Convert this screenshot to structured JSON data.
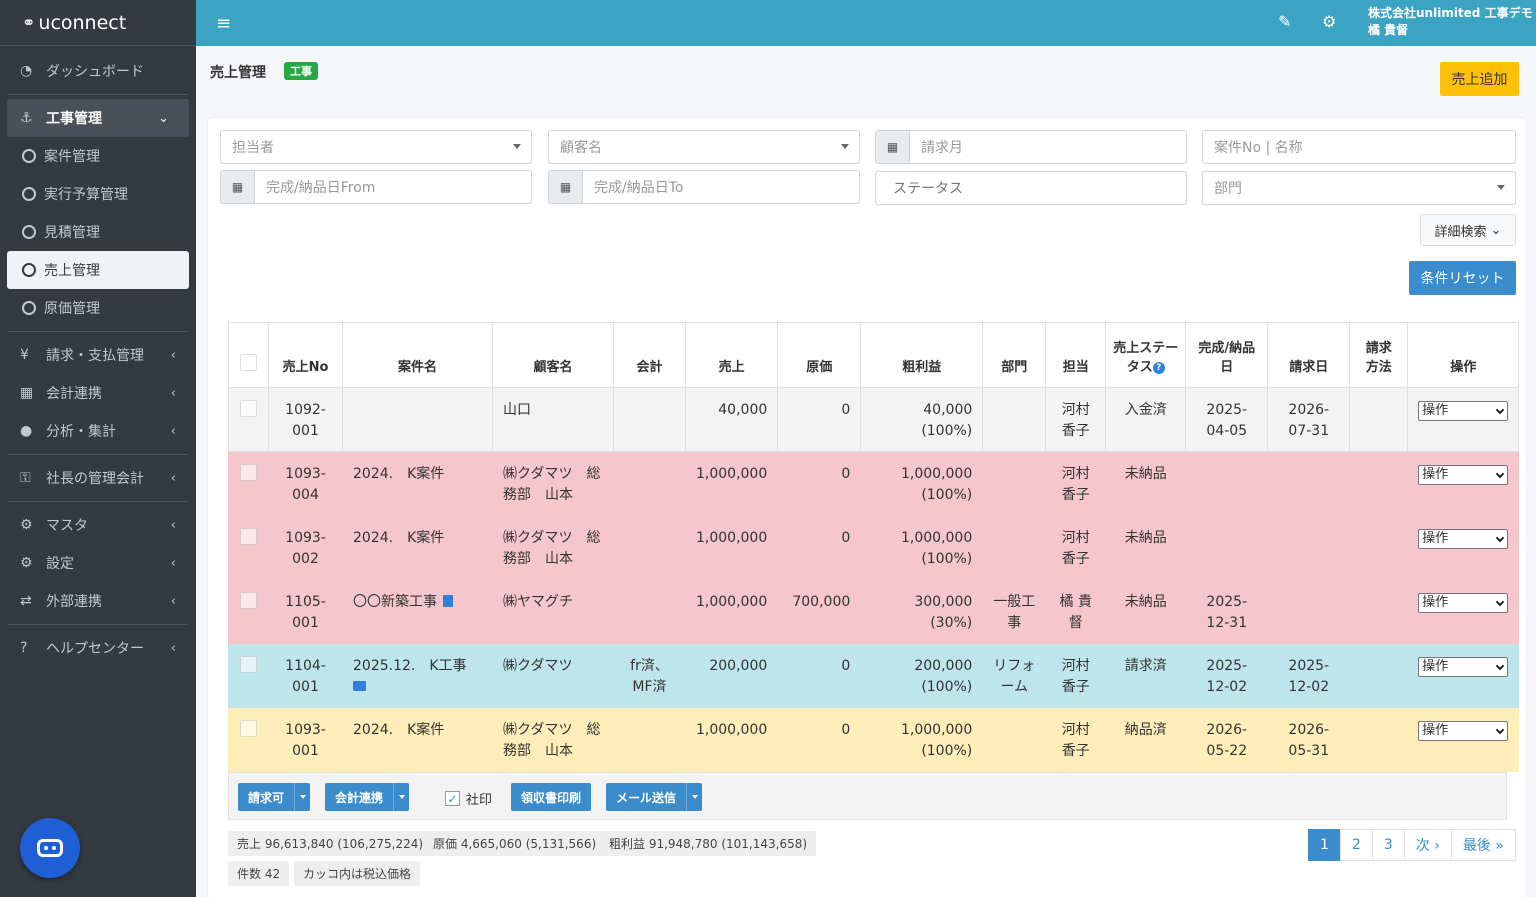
{
  "sidebar": {
    "brand": "uconnect",
    "items": [
      {
        "icon": "gauge-icon",
        "label": "ダッシュボード"
      },
      {
        "icon": "anchor-icon",
        "label": "工事管理"
      },
      {
        "label": "案件管理"
      },
      {
        "label": "実行予算管理"
      },
      {
        "label": "見積管理"
      },
      {
        "label": "売上管理"
      },
      {
        "label": "原価管理"
      },
      {
        "icon": "yen-icon",
        "label": "請求・支払管理"
      },
      {
        "icon": "calculator-icon",
        "label": "会計連携"
      },
      {
        "icon": "drop-icon",
        "label": "分析・集計"
      },
      {
        "icon": "key-icon",
        "label": "社長の管理会計"
      },
      {
        "icon": "gear-icon",
        "label": "マスタ"
      },
      {
        "icon": "gears-icon",
        "label": "設定"
      },
      {
        "icon": "exchange-icon",
        "label": "外部連携"
      },
      {
        "icon": "question-icon",
        "label": "ヘルプセンター"
      }
    ]
  },
  "topbar": {
    "company": "株式会社unlimited 工事デモ",
    "user": "橘 貴督"
  },
  "page": {
    "title": "売上管理",
    "badge": "工事",
    "add_button": "売上追加"
  },
  "filters": {
    "tantousha": "担当者",
    "kokyaku": "顧客名",
    "seikyu_month": "請求月",
    "anken": "案件No | 名称",
    "from": "完成/納品日From",
    "to": "完成/納品日To",
    "status": "ステータス",
    "bumon": "部門",
    "detail": "詳細検索",
    "reset": "条件リセット"
  },
  "table": {
    "headers": [
      "売上No",
      "案件名",
      "顧客名",
      "会計",
      "売上",
      "原価",
      "粗利益",
      "部門",
      "担当",
      "売上ステータス",
      "完成/納品日",
      "請求日",
      "請求方法",
      "操作"
    ],
    "rows": [
      {
        "no": "1092-001",
        "anken": "",
        "kokyaku": "山口",
        "kaikei": "",
        "uriage": "40,000",
        "genka": "0",
        "arari": "40,000",
        "arari_pct": "(100%)",
        "bumon": "",
        "tanto": "河村香子",
        "status": "入金済",
        "kansei": "2025-04-05",
        "seikyu": "2026-07-31",
        "hoho": "",
        "op": "操作"
      },
      {
        "no": "1093-004",
        "anken": "2024.　K案件",
        "kokyaku": "㈱クダマツ　総務部　山本",
        "kaikei": "",
        "uriage": "1,000,000",
        "genka": "0",
        "arari": "1,000,000",
        "arari_pct": "(100%)",
        "bumon": "",
        "tanto": "河村香子",
        "status": "未納品",
        "kansei": "",
        "seikyu": "",
        "hoho": "",
        "op": "操作"
      },
      {
        "no": "1093-002",
        "anken": "2024.　K案件",
        "kokyaku": "㈱クダマツ　総務部　山本",
        "kaikei": "",
        "uriage": "1,000,000",
        "genka": "0",
        "arari": "1,000,000",
        "arari_pct": "(100%)",
        "bumon": "",
        "tanto": "河村香子",
        "status": "未納品",
        "kansei": "",
        "seikyu": "",
        "hoho": "",
        "op": "操作"
      },
      {
        "no": "1105-001",
        "anken": "〇〇新築工事",
        "kokyaku": "㈱ヤマグチ",
        "kaikei": "",
        "uriage": "1,000,000",
        "genka": "700,000",
        "arari": "300,000",
        "arari_pct": "(30%)",
        "bumon": "一般工事",
        "tanto": "橘 貴督",
        "status": "未納品",
        "kansei": "2025-12-31",
        "seikyu": "",
        "hoho": "",
        "op": "操作"
      },
      {
        "no": "1104-001",
        "anken": "2025.12.　K工事",
        "kokyaku": "㈱クダマツ",
        "kaikei": "fr済、MF済",
        "uriage": "200,000",
        "genka": "0",
        "arari": "200,000",
        "arari_pct": "(100%)",
        "bumon": "リフォーム",
        "tanto": "河村香子",
        "status": "請求済",
        "kansei": "2025-12-02",
        "seikyu": "2025-12-02",
        "hoho": "",
        "op": "操作"
      },
      {
        "no": "1093-001",
        "anken": "2024.　K案件",
        "kokyaku": "㈱クダマツ　総務部　山本",
        "kaikei": "",
        "uriage": "1,000,000",
        "genka": "0",
        "arari": "1,000,000",
        "arari_pct": "(100%)",
        "bumon": "",
        "tanto": "河村香子",
        "status": "納品済",
        "kansei": "2026-05-22",
        "seikyu": "2026-05-31",
        "hoho": "",
        "op": "操作"
      }
    ]
  },
  "actions": {
    "seikyu": "請求可",
    "kaikei": "会計連携",
    "shain": "社印",
    "ryoshu": "領収書印刷",
    "mail": "メール送信"
  },
  "stats": {
    "uriage": "売上 96,613,840 (106,275,224)",
    "genka": "原価 4,665,060 (5,131,566)",
    "arari": "粗利益 91,948,780 (101,143,658)",
    "kensu": "件数 42",
    "note": "カッコ内は税込価格"
  },
  "pager": {
    "pages": [
      "1",
      "2",
      "3"
    ],
    "next": "次 ›",
    "last": "最後 »"
  }
}
